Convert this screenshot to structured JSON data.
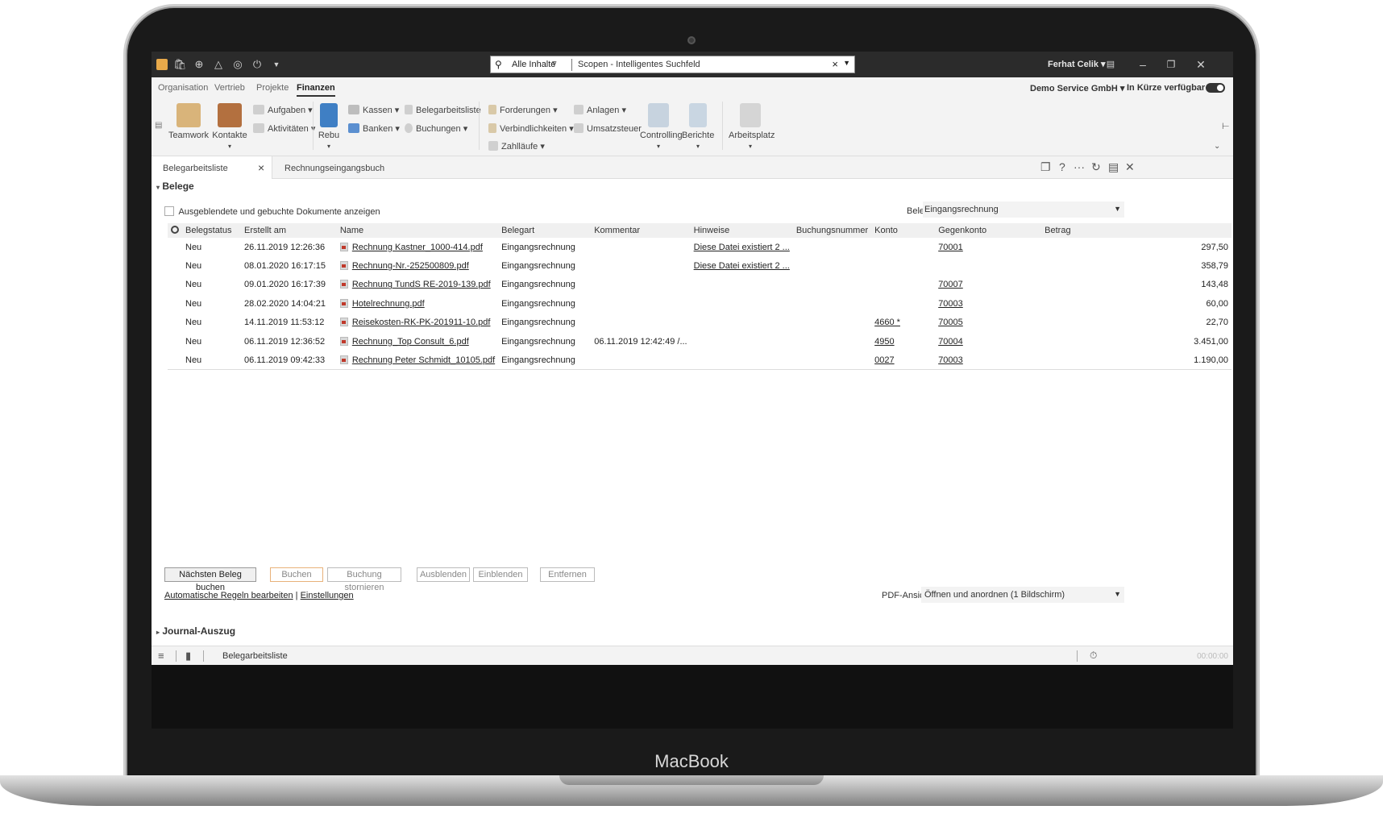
{
  "device": {
    "label": "MacBook"
  },
  "titlebar": {
    "search_scope": "Alle Inhalte",
    "search_text": "Scopen - Intelligentes Suchfeld",
    "user": "Ferhat Celik",
    "user_arrow": "▾",
    "icons": [
      "bag-icon",
      "plus-circle-icon",
      "megaphone-icon",
      "lifebuoy-icon",
      "power-icon",
      "dropdown-icon"
    ]
  },
  "menu": {
    "tabs": [
      "Organisation",
      "Vertrieb",
      "Projekte",
      "Finanzen"
    ],
    "active": "Finanzen",
    "company": "Demo Service GmbH",
    "company_arrow": "▾",
    "soon": "In Kürze verfügbar"
  },
  "ribbon": {
    "teamwork": "Teamwork",
    "kontakte": "Kontakte",
    "aufgaben": "Aufgaben",
    "aktivitaeten": "Aktivitäten",
    "rebu": "Rebu",
    "kassen": "Kassen",
    "banken": "Banken",
    "belegarbeitsliste": "Belegarbeitsliste",
    "buchungen": "Buchungen",
    "forderungen": "Forderungen",
    "verbindlichkeiten": "Verbindlichkeiten",
    "zahllaeufe": "Zahlläufe",
    "anlagen": "Anlagen",
    "umsatzsteuer": "Umsatzsteuer",
    "controlling": "Controlling",
    "berichte": "Berichte",
    "arbeitsplatz": "Arbeitsplatz",
    "arrow": "▾"
  },
  "doctabs": {
    "tab1": "Belegarbeitsliste",
    "tab2": "Rechnungseingangsbuch",
    "help": "?",
    "more": "···"
  },
  "belege": {
    "section_title": "Belege",
    "show_hidden_label": "Ausgeblendete und gebuchte Dokumente anzeigen",
    "belegart_label": "Belegart",
    "belegart_value": "Eingangsrechnung",
    "columns": [
      "Belegstatus",
      "Erstellt am",
      "Name",
      "Belegart",
      "Kommentar",
      "Hinweise",
      "Buchungsnummer",
      "Konto",
      "Gegenkonto",
      "Betrag"
    ],
    "rows": [
      {
        "status": "Neu",
        "created": "26.11.2019 12:26:36",
        "name": "Rechnung Kastner_1000-414.pdf",
        "belegart": "Eingangsrechnung",
        "kommentar": "",
        "hinweise": "Diese Datei existiert 2 ...",
        "buchungsnummer": "",
        "konto": "",
        "gegenkonto": "70001",
        "betrag": "297,50"
      },
      {
        "status": "Neu",
        "created": "08.01.2020 16:17:15",
        "name": "Rechnung-Nr.-252500809.pdf",
        "belegart": "Eingangsrechnung",
        "kommentar": "",
        "hinweise": "Diese Datei existiert 2 ...",
        "buchungsnummer": "",
        "konto": "",
        "gegenkonto": "",
        "betrag": "358,79"
      },
      {
        "status": "Neu",
        "created": "09.01.2020 16:17:39",
        "name": "Rechnung TundS RE-2019-139.pdf",
        "belegart": "Eingangsrechnung",
        "kommentar": "",
        "hinweise": "",
        "buchungsnummer": "",
        "konto": "",
        "gegenkonto": "70007",
        "betrag": "143,48"
      },
      {
        "status": "Neu",
        "created": "28.02.2020 14:04:21",
        "name": "Hotelrechnung.pdf",
        "belegart": "Eingangsrechnung",
        "kommentar": "",
        "hinweise": "",
        "buchungsnummer": "",
        "konto": "",
        "gegenkonto": "70003",
        "betrag": "60,00"
      },
      {
        "status": "Neu",
        "created": "14.11.2019 11:53:12",
        "name": "Reisekosten-RK-PK-201911-10.pdf",
        "belegart": "Eingangsrechnung",
        "kommentar": "",
        "hinweise": "",
        "buchungsnummer": "",
        "konto": "4660 *",
        "gegenkonto": "70005",
        "betrag": "22,70"
      },
      {
        "status": "Neu",
        "created": "06.11.2019 12:36:52",
        "name": "Rechnung_Top Consult_6.pdf",
        "belegart": "Eingangsrechnung",
        "kommentar": "06.11.2019 12:42:49 /...",
        "hinweise": "",
        "buchungsnummer": "",
        "konto": "4950",
        "gegenkonto": "70004",
        "betrag": "3.451,00"
      },
      {
        "status": "Neu",
        "created": "06.11.2019 09:42:33",
        "name": "Rechnung Peter Schmidt_10105.pdf",
        "belegart": "Eingangsrechnung",
        "kommentar": "",
        "hinweise": "",
        "buchungsnummer": "",
        "konto": "0027",
        "gegenkonto": "70003",
        "betrag": "1.190,00"
      }
    ]
  },
  "buttons": {
    "next": "Nächsten Beleg buchen",
    "buchen": "Buchen",
    "stornieren": "Buchung stornieren",
    "ausblenden": "Ausblenden",
    "einblenden": "Einblenden",
    "entfernen": "Entfernen"
  },
  "links": {
    "rules": "Automatische Regeln bearbeiten",
    "sep": "|",
    "settings": "Einstellungen"
  },
  "pdf_view": {
    "label": "PDF-Ansicht",
    "value": "Öffnen und anordnen (1 Bildschirm)"
  },
  "journal": {
    "title": "Journal-Auszug"
  },
  "statusbar": {
    "text": "Belegarbeitsliste",
    "time": "00:00:00"
  }
}
